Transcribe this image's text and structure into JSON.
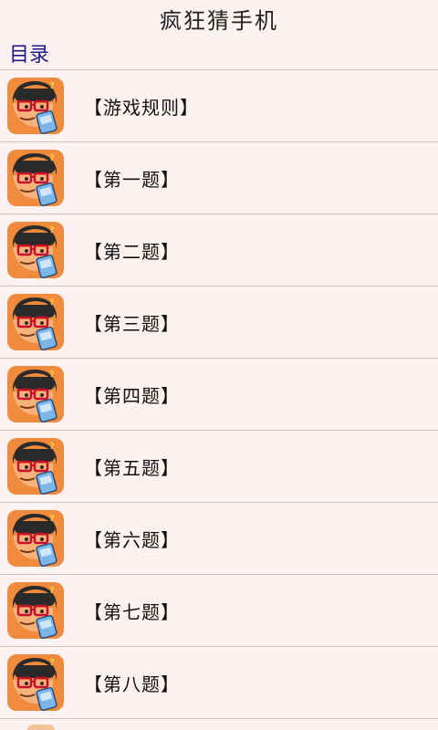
{
  "app": {
    "title": "疯狂猜手机"
  },
  "section": {
    "header": "目录"
  },
  "items": [
    {
      "label": "【游戏规则】"
    },
    {
      "label": "【第一题】"
    },
    {
      "label": "【第二题】"
    },
    {
      "label": "【第三题】"
    },
    {
      "label": "【第四题】"
    },
    {
      "label": "【第五题】"
    },
    {
      "label": "【第六题】"
    },
    {
      "label": "【第七题】"
    },
    {
      "label": "【第八题】"
    }
  ],
  "thumbnail": {
    "icon": "guessing-character-icon",
    "colors": {
      "background": "#f08a3c",
      "hair": "#2a2a2a",
      "glasses": "#c8102e",
      "phone": "#7ab6e8"
    }
  }
}
